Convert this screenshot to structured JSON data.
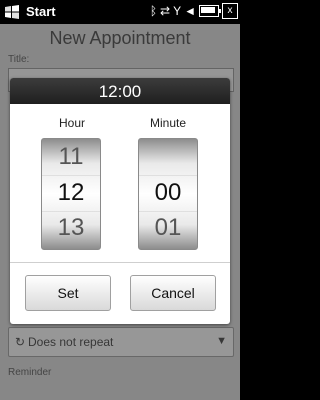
{
  "status_bar": {
    "start_label": "Start",
    "icons": [
      "windows-flag-icon",
      "bluetooth-icon",
      "data-transfer-icon",
      "signal-icon",
      "volume-icon",
      "battery-icon",
      "close-icon"
    ],
    "x_glyph": "x"
  },
  "background": {
    "title": "New Appointment",
    "title_label": "Title:",
    "repeat_value": "Does not repeat",
    "bottom_label": "Reminder"
  },
  "dialog": {
    "header_time": "12:00",
    "hour_label": "Hour",
    "minute_label": "Minute",
    "hour_values": [
      "11",
      "12",
      "13"
    ],
    "minute_values": [
      "",
      "00",
      "01"
    ],
    "set_label": "Set",
    "cancel_label": "Cancel"
  }
}
